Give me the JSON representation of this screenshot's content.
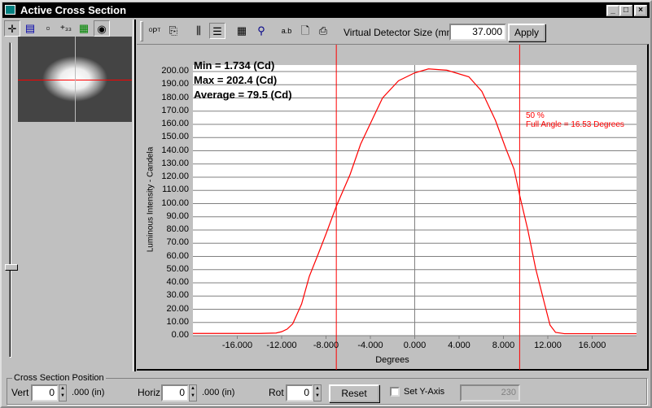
{
  "window": {
    "title": "Active Cross Section",
    "min_label": "_",
    "max_label": "□",
    "close_label": "×"
  },
  "left_toolbar": {
    "icons": [
      "crosshair-icon",
      "film-icon",
      "document-icon",
      "coordinate-icon",
      "grid-image-icon",
      "eye-icon"
    ]
  },
  "right_toolbar": {
    "icons": [
      "points-label-icon",
      "copy-icon",
      "vertical-grid-icon",
      "horizontal-grid-icon",
      "table-icon",
      "zoom-icon",
      "text-label-icon",
      "print-preview-icon",
      "print-icon"
    ],
    "detector_label": "Virtual Detector Size (mm)",
    "detector_value": "37.000",
    "apply_label": "Apply"
  },
  "stats": {
    "min": "Min = 1.734 (Cd)",
    "max": "Max = 202.4 (Cd)",
    "average": "Average = 79.5 (Cd)"
  },
  "annotation": {
    "percent": "50 %",
    "full_angle": "Full Angle = 16.53 Degrees"
  },
  "colors": {
    "curve": "#ff0000",
    "title_bar": "#000000"
  },
  "chart_data": {
    "type": "line",
    "xlabel": "Degrees",
    "ylabel": "Luminous Intensity - Candela",
    "xlim": [
      -20,
      20
    ],
    "ylim": [
      0,
      200
    ],
    "grid": true,
    "x_ticks": [
      "-16.000",
      "-12.000",
      "-8.000",
      "-4.000",
      "0.000",
      "4.000",
      "8.000",
      "12.000",
      "16.000"
    ],
    "y_ticks": [
      "0.00",
      "10.00",
      "20.00",
      "30.00",
      "40.00",
      "50.00",
      "60.00",
      "70.00",
      "80.00",
      "90.00",
      "100.00",
      "110.00",
      "120.00",
      "130.00",
      "140.00",
      "150.00",
      "160.00",
      "170.00",
      "180.00",
      "190.00",
      "200.00"
    ],
    "markers_x": [
      -7.07,
      9.46
    ],
    "x": [
      -20,
      -14,
      -12.5,
      -12,
      -11.5,
      -11,
      -10.2,
      -9.5,
      -8.74,
      -8,
      -7.07,
      -5.83,
      -4.88,
      -3.64,
      -2.9,
      -1.46,
      0,
      1.24,
      2.9,
      4.88,
      6.05,
      7.28,
      8.2,
      8.96,
      9.47,
      10.2,
      10.9,
      11.65,
      12.2,
      12.7,
      13.5,
      20
    ],
    "y": [
      1.7,
      1.7,
      2,
      3,
      5,
      9,
      24,
      45,
      61,
      77,
      98,
      122,
      145,
      167,
      180,
      193,
      199,
      202,
      201,
      196,
      185,
      163,
      142,
      126,
      106,
      80,
      51,
      26,
      8,
      2.5,
      1.5,
      1.5
    ]
  },
  "cross_section": {
    "group_label": "Cross Section Position",
    "vert_label": "Vert",
    "vert_value": "0",
    "vert_unit": ".000 (in)",
    "horiz_label": "Horiz",
    "horiz_value": "0",
    "horiz_unit": ".000 (in)",
    "rot_label": "Rot",
    "rot_value": "0",
    "reset_label": "Reset",
    "set_y_label": "Set Y-Axis",
    "set_y_value": "230"
  }
}
